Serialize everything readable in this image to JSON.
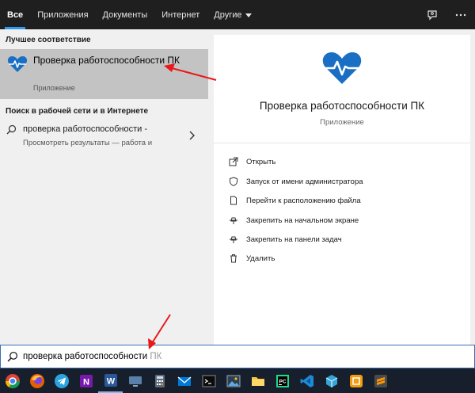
{
  "tabs": [
    {
      "label": "Все",
      "active": true
    },
    {
      "label": "Приложения"
    },
    {
      "label": "Документы"
    },
    {
      "label": "Интернет"
    },
    {
      "label": "Другие",
      "dropdown": true
    }
  ],
  "topbar_icons": [
    "feedback-icon",
    "more-options-icon"
  ],
  "left": {
    "best_match_header": "Лучшее соответствие",
    "best_match": {
      "icon": "health-check-heart-icon",
      "title": "Проверка работоспособности ПК",
      "subtitle": "Приложение"
    },
    "web_header": "Поиск в рабочей сети и в Интернете",
    "web_item": {
      "query": "проверка работоспособности -",
      "description": "Просмотреть результаты — работа и"
    }
  },
  "right": {
    "app_title": "Проверка работоспособности ПК",
    "app_type": "Приложение",
    "actions": [
      {
        "label": "Открыть",
        "icon": "open-icon"
      },
      {
        "label": "Запуск от имени администратора",
        "icon": "shield-icon"
      },
      {
        "label": "Перейти к расположению файла",
        "icon": "file-location-icon"
      },
      {
        "label": "Закрепить на начальном экране",
        "icon": "pin-icon"
      },
      {
        "label": "Закрепить на панели задач",
        "icon": "pin-icon"
      },
      {
        "label": "Удалить",
        "icon": "trash-icon"
      }
    ]
  },
  "search": {
    "typed": "проверка работоспособности",
    "suggestion": " ПК"
  },
  "taskbar": [
    "chrome-icon",
    "firefox-icon",
    "telegram-icon",
    "onenote-icon",
    "word-icon",
    "monitor-icon",
    "calculator-icon",
    "mail-icon",
    "terminal-icon",
    "image-viewer-icon",
    "file-explorer-icon",
    "pycharm-icon",
    "vscode-icon",
    "sandbox-icon",
    "app-icon",
    "sublime-text-icon"
  ],
  "colors": {
    "accent": "#2f9af5",
    "selected_bg": "#c3c3c3",
    "heart": "#1a6fc4",
    "arrow": "#e8191c",
    "taskbar": "#171f2c"
  }
}
